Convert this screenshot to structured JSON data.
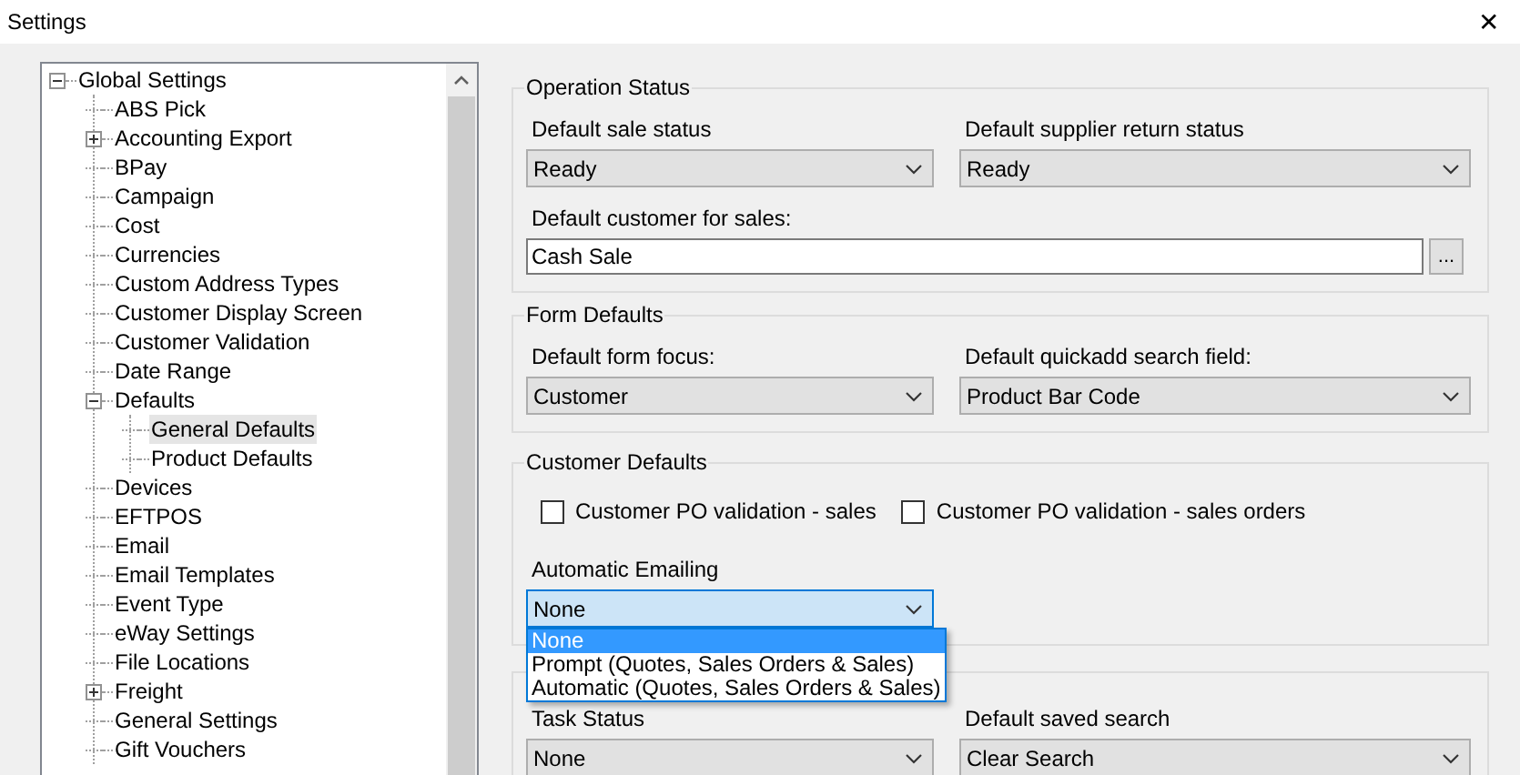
{
  "window": {
    "title": "Settings",
    "close": "✕"
  },
  "tree": [
    {
      "label": "Global Settings",
      "expanded": true,
      "selected": false,
      "children": [
        {
          "label": "ABS Pick",
          "selected": false
        },
        {
          "label": "Accounting Export",
          "expanded": false,
          "selected": false
        },
        {
          "label": "BPay",
          "selected": false
        },
        {
          "label": "Campaign",
          "selected": false
        },
        {
          "label": "Cost",
          "selected": false
        },
        {
          "label": "Currencies",
          "selected": false
        },
        {
          "label": "Custom Address Types",
          "selected": false
        },
        {
          "label": "Customer Display Screen",
          "selected": false
        },
        {
          "label": "Customer Validation",
          "selected": false
        },
        {
          "label": "Date Range",
          "selected": false
        },
        {
          "label": "Defaults",
          "expanded": true,
          "selected": false,
          "children": [
            {
              "label": "General Defaults",
              "selected": true
            },
            {
              "label": "Product Defaults",
              "selected": false
            }
          ]
        },
        {
          "label": "Devices",
          "selected": false
        },
        {
          "label": "EFTPOS",
          "selected": false
        },
        {
          "label": "Email",
          "selected": false
        },
        {
          "label": "Email Templates",
          "selected": false
        },
        {
          "label": "Event Type",
          "selected": false
        },
        {
          "label": "eWay Settings",
          "selected": false
        },
        {
          "label": "File Locations",
          "selected": false
        },
        {
          "label": "Freight",
          "expanded": false,
          "selected": false
        },
        {
          "label": "General Settings",
          "selected": false
        },
        {
          "label": "Gift Vouchers",
          "selected": false
        }
      ]
    }
  ],
  "groups": [
    {
      "title": "Operation Status",
      "fields": [
        {
          "kind": "select",
          "label": "Default sale status",
          "value": "Ready"
        },
        {
          "kind": "select",
          "label": "Default supplier return status",
          "value": "Ready"
        },
        {
          "kind": "lookup",
          "label": "Default customer for sales:",
          "value": "Cash Sale",
          "button": "..."
        }
      ]
    },
    {
      "title": "Form Defaults",
      "fields": [
        {
          "kind": "select",
          "label": "Default form focus:",
          "value": "Customer"
        },
        {
          "kind": "select",
          "label": "Default quickadd search field:",
          "value": "Product Bar Code"
        }
      ]
    },
    {
      "title": "Customer Defaults",
      "fields": [
        {
          "kind": "checkbox",
          "label": "Customer PO validation - sales",
          "checked": false
        },
        {
          "kind": "checkbox",
          "label": "Customer PO validation - sales orders",
          "checked": false
        },
        {
          "kind": "select",
          "label": "Automatic Emailing",
          "value": "None",
          "open": true,
          "options": [
            {
              "label": "None",
              "selected": true
            },
            {
              "label": "Prompt (Quotes, Sales Orders & Sales)",
              "selected": false
            },
            {
              "label": "Automatic (Quotes, Sales Orders & Sales)",
              "selected": false
            }
          ]
        }
      ]
    },
    {
      "fields": [
        {
          "kind": "select",
          "label": "Task Status",
          "value": "None"
        },
        {
          "kind": "select",
          "label": "Default saved search",
          "value": "Clear Search"
        }
      ]
    }
  ]
}
